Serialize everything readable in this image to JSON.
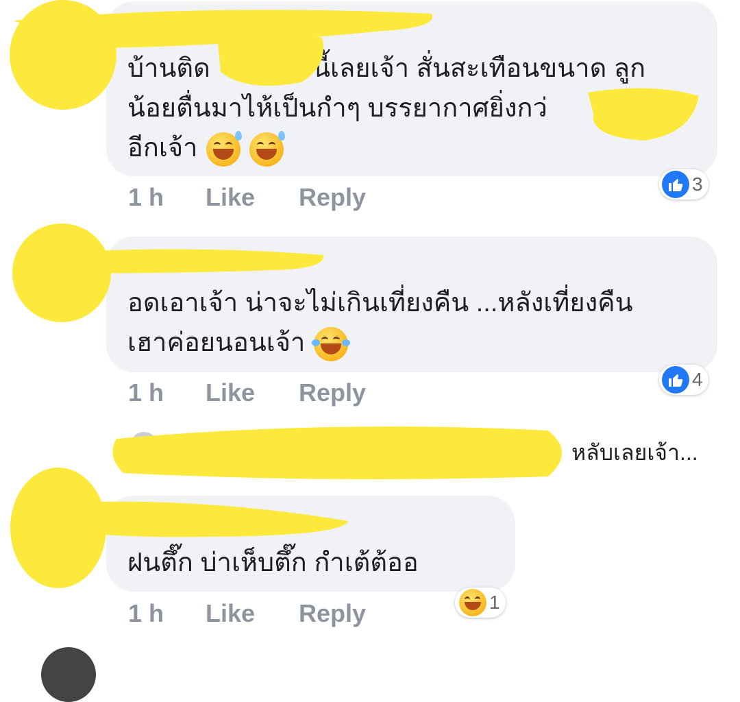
{
  "comments": [
    {
      "text_lines": [
        "บ้านติด",
        "นี้เลยเจ้า สั่นสะเทือนขนาด ลูก",
        "น้อยตื่นมาไห้เป็นกำๆ บรรยากาศยิ่งกว่",
        "อีกเจ้า"
      ],
      "time": "1 h",
      "like_label": "Like",
      "reply_label": "Reply",
      "reaction_icon": "like-icon",
      "reaction_count": "3"
    },
    {
      "text_lines": [
        "อดเอาเจ้า น่าจะไม่เกินเที่ยงคืน ...หลังเที่ยงคืน",
        "เฮาค่อยนอนเจ้า"
      ],
      "time": "1 h",
      "like_label": "Like",
      "reply_label": "Reply",
      "reaction_icon": "like-icon",
      "reaction_count": "4"
    },
    {
      "collapsed_preview": "หลับเลยเจ้า..."
    },
    {
      "text_lines": [
        "ฝนตึ๊ก  บ่าเห็บตึ๊ก  กำเต้ต้ออ"
      ],
      "time": "1 h",
      "like_label": "Like",
      "reply_label": "Reply",
      "reaction_icon": "laughing-icon",
      "reaction_count": "1"
    }
  ],
  "colors": {
    "bubble": "#f0f2f5",
    "meta_text": "#8d949e",
    "like_blue": "#2078f4",
    "redaction_yellow": "#fde93b"
  }
}
